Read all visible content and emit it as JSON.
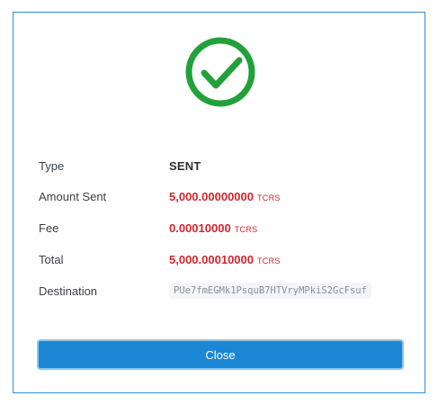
{
  "icon": "check-circle-icon",
  "colors": {
    "success": "#22a13a",
    "amount": "#d0262d",
    "accent": "#1b86d4",
    "border": "#2f8fd8"
  },
  "details": {
    "type": {
      "label": "Type",
      "value": "SENT"
    },
    "amount_sent": {
      "label": "Amount Sent",
      "value": "5,000.00000000",
      "unit": "TCRS"
    },
    "fee": {
      "label": "Fee",
      "value": "0.00010000",
      "unit": "TCRS"
    },
    "total": {
      "label": "Total",
      "value": "5,000.00010000",
      "unit": "TCRS"
    },
    "destination": {
      "label": "Destination",
      "value": "PUe7fmEGMk1PsquB7HTVryMPkiS2GcFsuf"
    }
  },
  "actions": {
    "close_label": "Close"
  }
}
